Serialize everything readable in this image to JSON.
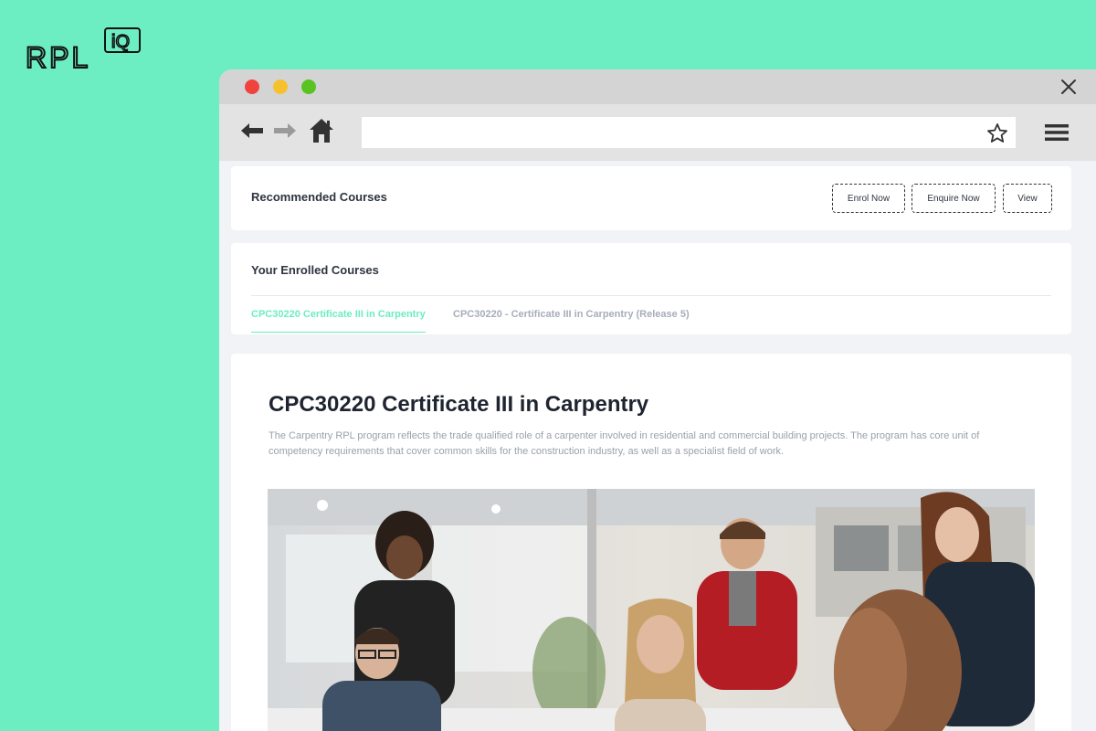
{
  "logo": {
    "text": "RPL",
    "badge": "iQ"
  },
  "browser": {
    "window_controls": [
      "red-dot",
      "yellow-dot",
      "green-dot"
    ],
    "toolbar": {
      "address_value": "",
      "icons": [
        "back-arrow-icon",
        "forward-arrow-icon",
        "home-icon",
        "star-icon",
        "hamburger-menu-icon",
        "close-icon"
      ]
    }
  },
  "recommended": {
    "title": "Recommended Courses",
    "buttons": {
      "enrol": "Enrol Now",
      "enquire": "Enquire Now",
      "view": "View"
    }
  },
  "enrolled": {
    "title": "Your Enrolled Courses",
    "tabs": [
      {
        "label": "CPC30220 Certificate III in Carpentry",
        "active": true
      },
      {
        "label": "CPC30220 - Certificate III in Carpentry (Release 5)",
        "active": false
      }
    ]
  },
  "course": {
    "title": "CPC30220 Certificate III in Carpentry",
    "description": "The Carpentry RPL program reflects the trade qualified role of a carpenter involved in residential and commercial building projects. The program has core unit of competency requirements that cover common skills for the construction industry, as well as a specialist field of work."
  },
  "colors": {
    "background": "#6cedc2",
    "accent": "#6cedc2",
    "text_dark": "#1e2430",
    "text_muted": "#9aa0ab"
  }
}
